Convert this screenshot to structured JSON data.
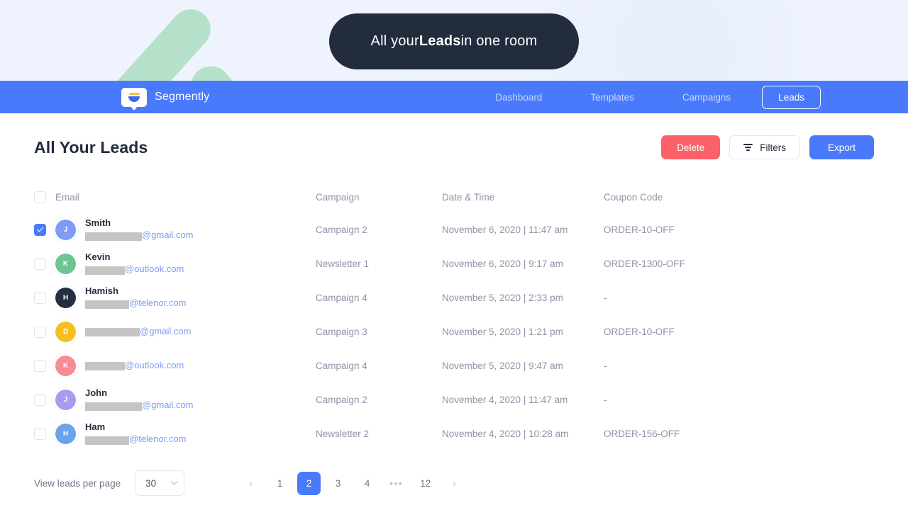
{
  "hero": {
    "banner_prefix": "All your ",
    "banner_highlight": "Leads",
    "banner_suffix": " in one room",
    "pill_bg": "#232c3d",
    "bg_color": "#eef3fd",
    "accent_green": "#b5e0ca",
    "accent_navy": "#2b3473"
  },
  "nav": {
    "brand": "Segmently",
    "brand_icon": "funnel-bubble-logo",
    "bg_color": "#4a7afc",
    "links": [
      {
        "label": "Dashboard",
        "active": false
      },
      {
        "label": "Templates",
        "active": false
      },
      {
        "label": "Campaigns",
        "active": false
      },
      {
        "label": "Leads",
        "active": true
      }
    ]
  },
  "page": {
    "title": "All Your Leads",
    "buttons": {
      "delete": "Delete",
      "filters": "Filters",
      "export": "Export",
      "delete_color": "#fa6168",
      "export_color": "#4a7afc"
    }
  },
  "table": {
    "headers": {
      "email": "Email",
      "campaign": "Campaign",
      "date": "Date & Time",
      "coupon": "Coupon Code"
    },
    "rows": [
      {
        "selected": true,
        "avatar_letter": "J",
        "avatar_color": "#7f9bf5",
        "name": "Smith",
        "redact_width": 80,
        "domain": "@gmail.com",
        "campaign": "Campaign 2",
        "date": "November 6, 2020 | 11:47 am",
        "coupon": "ORDER-10-OFF"
      },
      {
        "selected": false,
        "avatar_letter": "K",
        "avatar_color": "#6ec493",
        "name": "Kevin",
        "redact_width": 56,
        "domain": "@outlook.com",
        "campaign": "Newsletter 1",
        "date": "November 6, 2020 | 9:17 am",
        "coupon": "ORDER-1300-OFF"
      },
      {
        "selected": false,
        "avatar_letter": "H",
        "avatar_color": "#252f42",
        "name": "Hamish",
        "redact_width": 62,
        "domain": "@telenor.com",
        "campaign": "Campaign 4",
        "date": "November 5, 2020 | 2:33 pm",
        "coupon": "-"
      },
      {
        "selected": false,
        "avatar_letter": "D",
        "avatar_color": "#f5c01e",
        "name": "",
        "redact_width": 77,
        "domain": "@gmail.com",
        "campaign": "Campaign 3",
        "date": "November 5, 2020 | 1:21 pm",
        "coupon": "ORDER-10-OFF"
      },
      {
        "selected": false,
        "avatar_letter": "K",
        "avatar_color": "#f78b96",
        "name": "",
        "redact_width": 56,
        "domain": "@outlook.com",
        "campaign": "Campaign 4",
        "date": "November 5, 2020 | 9:47 am",
        "coupon": "-"
      },
      {
        "selected": false,
        "avatar_letter": "J",
        "avatar_color": "#a99bf0",
        "name": "John",
        "redact_width": 80,
        "domain": "@gmail.com",
        "campaign": "Campaign 2",
        "date": "November 4, 2020 | 11:47 am",
        "coupon": "-"
      },
      {
        "selected": false,
        "avatar_letter": "H",
        "avatar_color": "#6aa3ea",
        "name": "Ham",
        "redact_width": 62,
        "domain": "@telenor.com",
        "campaign": "Newsletter 2",
        "date": "November 4, 2020 | 10:28 am",
        "coupon": "ORDER-156-OFF"
      }
    ]
  },
  "footer": {
    "per_page_label": "View leads per page",
    "per_page_value": "30",
    "pagination": {
      "prev": "‹",
      "next": "›",
      "pages": [
        "1",
        "2",
        "3",
        "4",
        "•••",
        "12"
      ],
      "current": "2",
      "active_color": "#4a7afc"
    }
  }
}
